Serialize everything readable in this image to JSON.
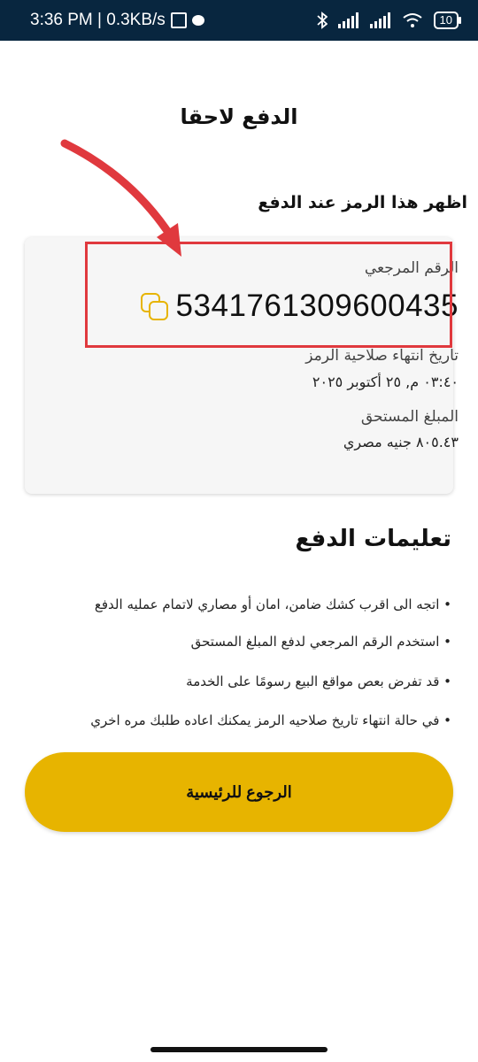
{
  "status_bar": {
    "time_speed": "3:36 PM | 0.3KB/s",
    "battery_level": "10",
    "icons": [
      "nfc-icon",
      "chat-icon",
      "bluetooth-icon",
      "signal-icon",
      "signal-icon",
      "wifi-icon",
      "battery-icon"
    ]
  },
  "header": {
    "title": "الدفع لاحقا"
  },
  "subtitle": "اظهر هذا الرمز عند الدفع",
  "card": {
    "reference_label": "الرقم المرجعي",
    "reference_number": "5341761309600435",
    "expiry_label": "تاريخ انتهاء صلاحية الرمز",
    "expiry_value": "٠٣:٤٠ م, ٢٥ أكتوبر ٢٠٢٥",
    "amount_label": "المبلغ المستحق",
    "amount_value": "٨٠٥.٤٣ جنيه مصري"
  },
  "instructions": {
    "title": "تعليمات الدفع",
    "items": [
      "• اتجه الى اقرب كشك ضامن، امان أو مصاري لاتمام عمليه الدفع",
      "• استخدم الرقم المرجعي لدفع المبلغ المستحق",
      "• قد تفرض بعص مواقع البيع رسومًا على الخدمة",
      "• في حالة انتهاء تاريخ صلاحيه الرمز يمكنك اعاده طلبك مره اخري"
    ]
  },
  "actions": {
    "home_label": "الرجوع للرئيسية"
  },
  "colors": {
    "accent": "#e7b400",
    "status_bar": "#08263f",
    "annotation": "#e0393e"
  }
}
